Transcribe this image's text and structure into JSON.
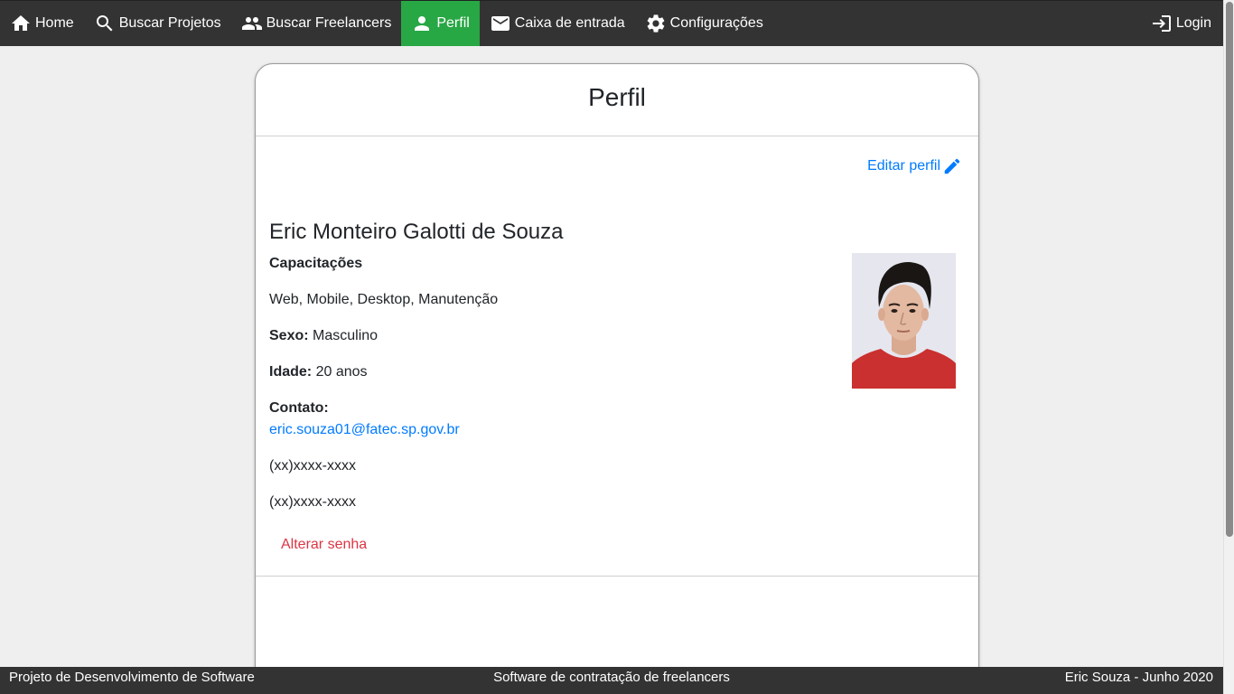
{
  "nav": {
    "home": "Home",
    "buscar_projetos": "Buscar Projetos",
    "buscar_freelancers": "Buscar Freelancers",
    "perfil": "Perfil",
    "caixa_entrada": "Caixa de entrada",
    "configuracoes": "Configurações",
    "login": "Login",
    "active_color": "#28a745",
    "bar_color": "#333333"
  },
  "card": {
    "title": "Perfil",
    "edit_label": "Editar perfil",
    "name": "Eric Monteiro Galotti de Souza",
    "capacitacoes_label": "Capacitações",
    "capacitacoes_value": "Web, Mobile, Desktop, Manutenção",
    "sexo_label": "Sexo:",
    "sexo_value": "Masculino",
    "idade_label": "Idade:",
    "idade_value": "20 anos",
    "contato_label": "Contato:",
    "email": "eric.souza01@fatec.sp.gov.br",
    "phone1": "(xx)xxxx-xxxx",
    "phone2": "(xx)xxxx-xxxx",
    "change_password": "Alterar senha"
  },
  "footer": {
    "left": "Projeto de Desenvolvimento de Software",
    "center": "Software de contratação de freelancers",
    "right": "Eric Souza - Junho 2020"
  }
}
